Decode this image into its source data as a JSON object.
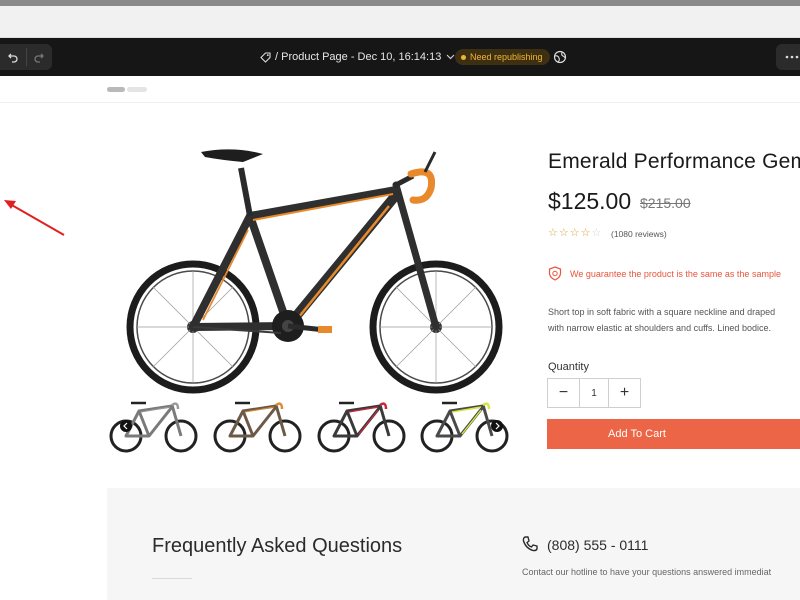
{
  "editor": {
    "page_label": "/ Product Page - Dec 10, 16:14:13",
    "status_badge": "Need republishing",
    "icons": [
      "undo-icon",
      "redo-icon",
      "tag-icon",
      "chevron-down-icon",
      "globe-icon",
      "more-icon"
    ]
  },
  "product": {
    "title": "Emerald Performance Gem",
    "price": "$125.00",
    "original_price": "$215.00",
    "rating": 0,
    "rating_max": 5,
    "reviews": "(1080 reviews)",
    "guarantee": "We guarantee the product is the same as the sample",
    "description": "Short top in soft fabric with a square neckline and draped\nwith narrow elastic at shoulders and cuffs. Lined bodice.",
    "thumbnails": [
      {
        "frame": "#7a7a7a",
        "accent": "#9a9a9a",
        "nav": "left"
      },
      {
        "frame": "#6b5a48",
        "accent": "#e08a2e",
        "nav": ""
      },
      {
        "frame": "#3a3a3a",
        "accent": "#c8283a",
        "nav": ""
      },
      {
        "frame": "#4a4a4a",
        "accent": "#d6e83a",
        "nav": "right"
      }
    ]
  },
  "cart": {
    "quantity_label": "Quantity",
    "quantity": "1",
    "minus": "−",
    "plus": "+",
    "add_to_cart": "Add To Cart"
  },
  "faq": {
    "title": "Frequently Asked Questions",
    "phone": "(808) 555 - 0111",
    "hotline_text": "Contact our hotline to have your questions answered immediat"
  },
  "colors": {
    "accent": "#ec6546",
    "badge_text": "#f1b431",
    "bike_frame": "#2f2f2f",
    "bike_accent": "#e88a2c",
    "annotation_arrow": "#e02020"
  }
}
